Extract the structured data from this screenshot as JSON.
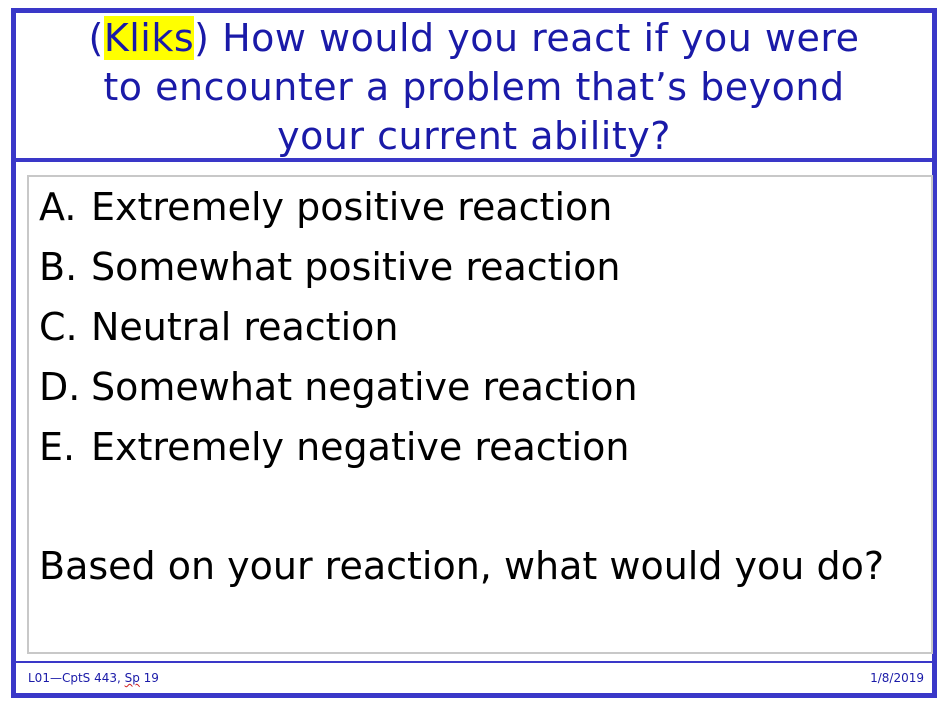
{
  "title": {
    "open_paren": "(",
    "highlight": "Kliks",
    "line1_rest": ") How would you react if you were",
    "line2": "to encounter a problem that’s beyond",
    "line3": "your current ability?"
  },
  "choices": [
    {
      "letter": "A.",
      "text": "Extremely positive reaction"
    },
    {
      "letter": "B.",
      "text": "Somewhat positive reaction"
    },
    {
      "letter": "C.",
      "text": "Neutral reaction"
    },
    {
      "letter": "D.",
      "text": "Somewhat negative reaction"
    },
    {
      "letter": "E.",
      "text": "Extremely negative reaction"
    }
  ],
  "followup": "Based on your reaction, what would you do?",
  "footer": {
    "course_prefix": "L01—CptS 443, ",
    "course_sp": "Sp",
    "course_suffix": " 19",
    "date": "1/8/2019"
  },
  "colors": {
    "border": "#3a38c8",
    "title_text": "#1a1aa8",
    "highlight": "#ffff00"
  }
}
